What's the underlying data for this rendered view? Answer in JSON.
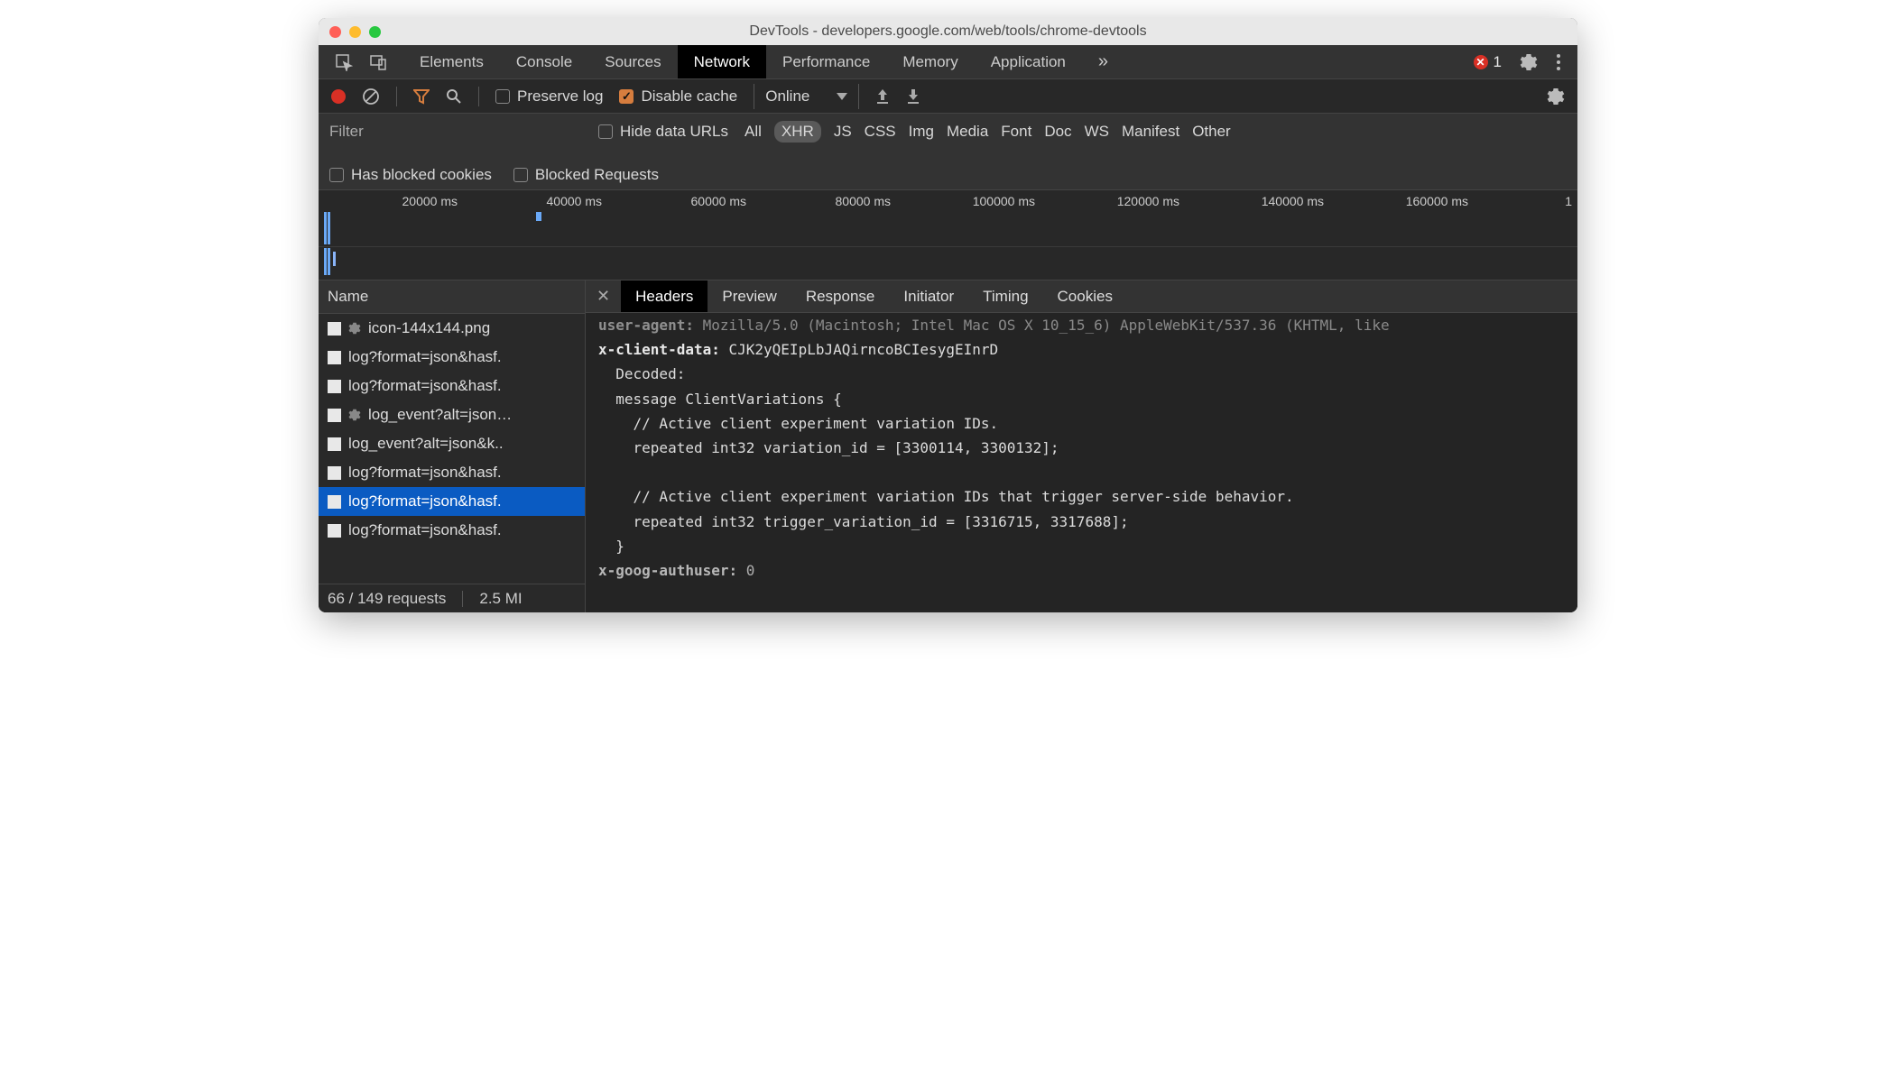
{
  "window": {
    "title": "DevTools - developers.google.com/web/tools/chrome-devtools"
  },
  "tabs": {
    "items": [
      "Elements",
      "Console",
      "Sources",
      "Network",
      "Performance",
      "Memory",
      "Application"
    ],
    "active": "Network",
    "overflow_glyph": "»",
    "error_count": "1"
  },
  "net_toolbar": {
    "preserve_log": "Preserve log",
    "disable_cache": "Disable cache",
    "throttling": "Online"
  },
  "filter": {
    "placeholder": "Filter",
    "hide_data_urls": "Hide data URLs",
    "types": [
      "All",
      "XHR",
      "JS",
      "CSS",
      "Img",
      "Media",
      "Font",
      "Doc",
      "WS",
      "Manifest",
      "Other"
    ],
    "active_type": "XHR",
    "has_blocked_cookies": "Has blocked cookies",
    "blocked_requests": "Blocked Requests"
  },
  "timeline": {
    "labels": [
      "20000 ms",
      "40000 ms",
      "60000 ms",
      "80000 ms",
      "100000 ms",
      "120000 ms",
      "140000 ms",
      "160000 ms"
    ],
    "last_tick": "1"
  },
  "requests": {
    "header": "Name",
    "items": [
      {
        "name": "icon-144x144.png",
        "gear": true
      },
      {
        "name": "log?format=json&hasf."
      },
      {
        "name": "log?format=json&hasf."
      },
      {
        "name": "log_event?alt=json…",
        "gear": true
      },
      {
        "name": "log_event?alt=json&k.."
      },
      {
        "name": "log?format=json&hasf."
      },
      {
        "name": "log?format=json&hasf.",
        "selected": true
      },
      {
        "name": "log?format=json&hasf."
      }
    ],
    "status_requests": "66 / 149 requests",
    "status_size": "2.5 MI"
  },
  "details": {
    "tabs": [
      "Headers",
      "Preview",
      "Response",
      "Initiator",
      "Timing",
      "Cookies"
    ],
    "active": "Headers",
    "headers": {
      "user_agent_name": "user-agent:",
      "user_agent_value": "Mozilla/5.0 (Macintosh; Intel Mac OS X 10_15_6) AppleWebKit/537.36 (KHTML, like",
      "x_client_data_name": "x-client-data:",
      "x_client_data_value": "CJK2yQEIpLbJAQirncoBCIesygEInrD",
      "decoded_label": "Decoded:",
      "msg_open": "message ClientVariations {",
      "comment1": "// Active client experiment variation IDs.",
      "line1": "repeated int32 variation_id = [3300114, 3300132];",
      "comment2": "// Active client experiment variation IDs that trigger server-side behavior.",
      "line2": "repeated int32 trigger_variation_id = [3316715, 3317688];",
      "msg_close": "}",
      "x_goog_authuser_name": "x-goog-authuser:",
      "x_goog_authuser_value": "0"
    }
  }
}
